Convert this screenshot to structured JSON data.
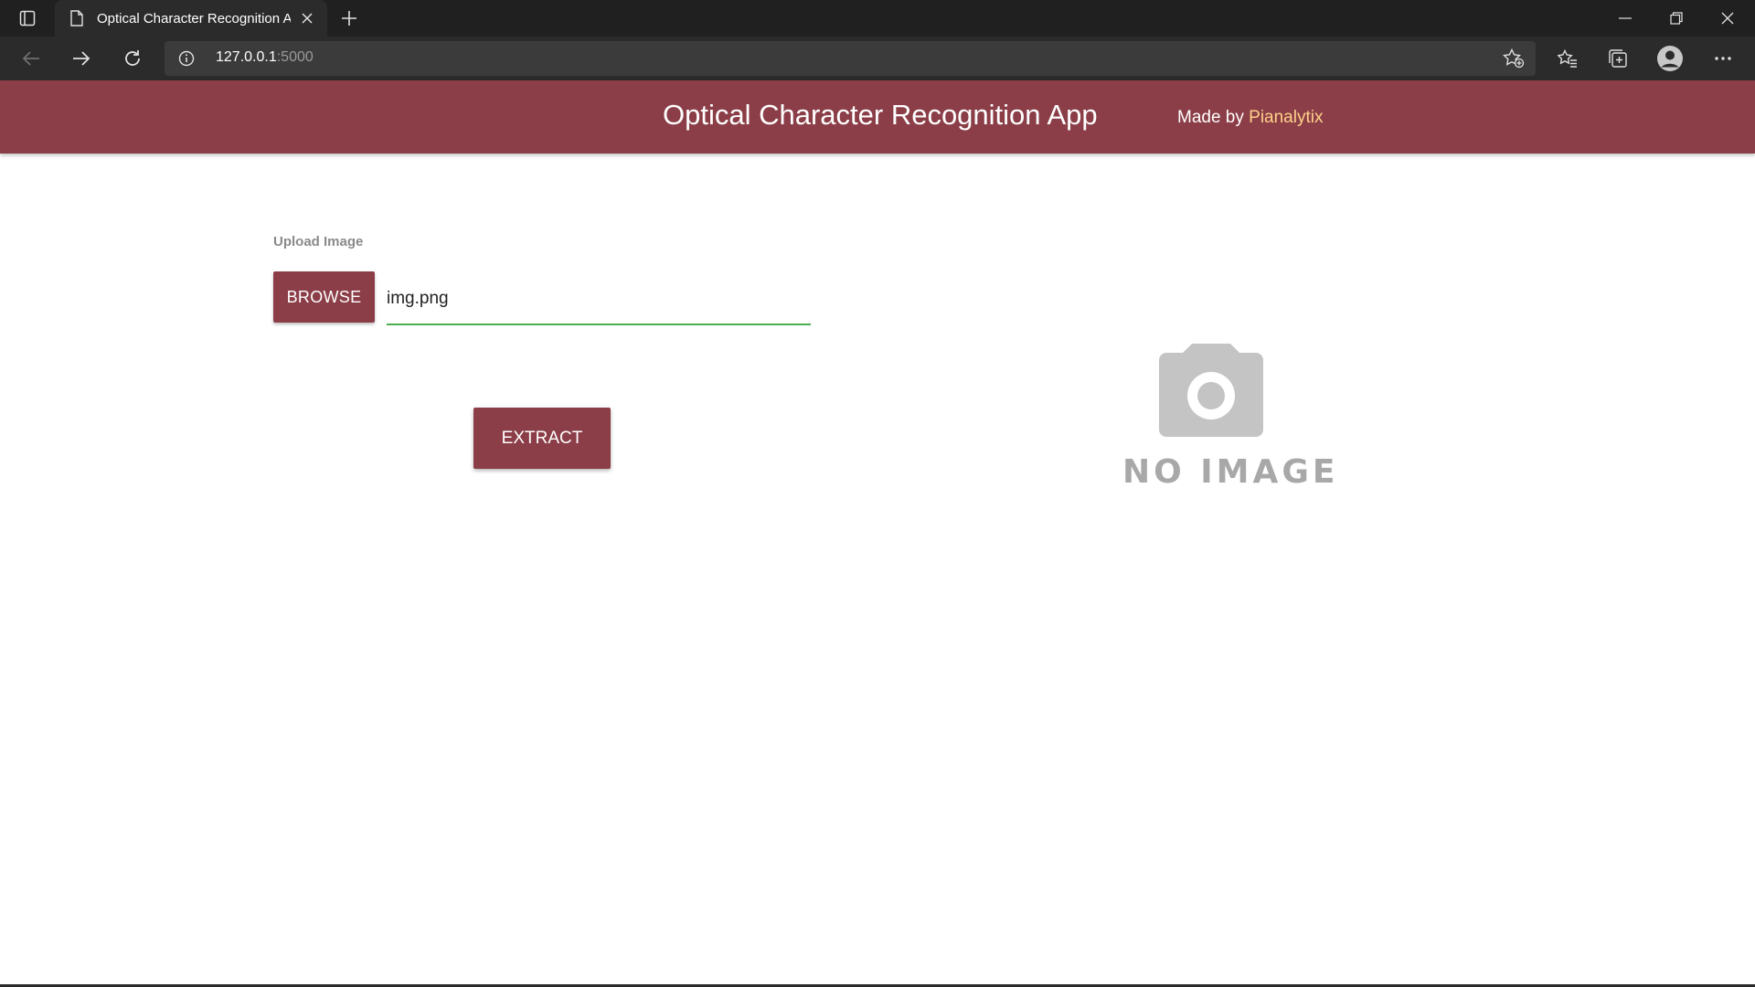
{
  "browser": {
    "tab_title": "Optical Character Recognition Ap",
    "url_host": "127.0.0.1",
    "url_port": ":5000"
  },
  "app": {
    "title": "Optical Character Recognition App",
    "made_by_prefix": "Made by ",
    "made_by_brand": "Pianalytix",
    "upload_label": "Upload Image",
    "browse_label": "BROWSE",
    "file_value": "img.png",
    "extract_label": "EXTRACT",
    "placeholder_text": "NO IMAGE"
  },
  "colors": {
    "accent": "#8b3e47",
    "brand_link": "#ffd08a",
    "input_underline": "#4caf50"
  }
}
